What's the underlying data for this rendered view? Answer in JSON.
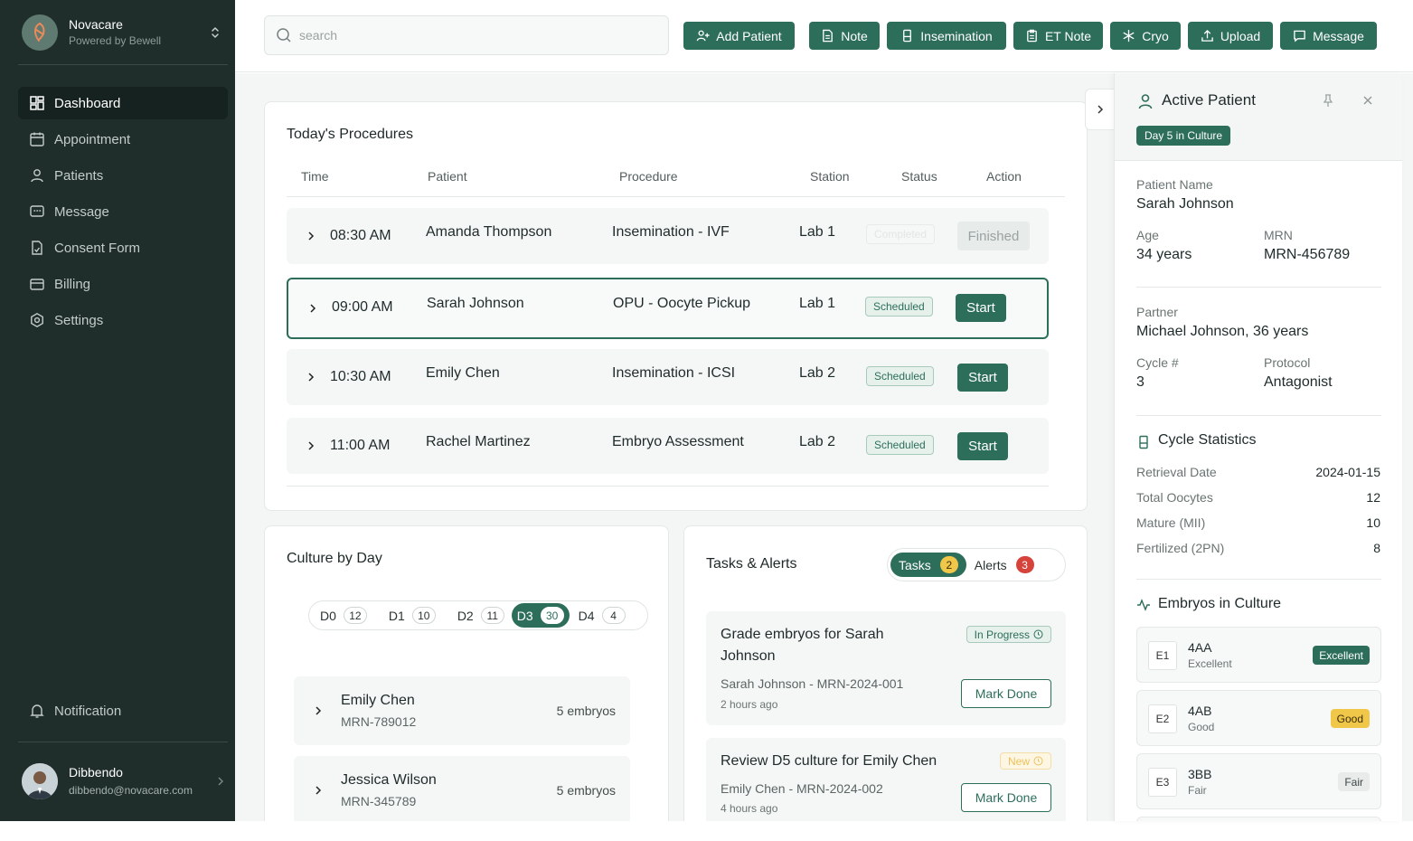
{
  "brand": {
    "name": "Novacare",
    "sub": "Powered by Bewell"
  },
  "nav": [
    {
      "label": "Dashboard",
      "icon": "dashboard-icon",
      "active": true
    },
    {
      "label": "Appointment",
      "icon": "calendar-icon"
    },
    {
      "label": "Patients",
      "icon": "user-icon"
    },
    {
      "label": "Message",
      "icon": "message-icon"
    },
    {
      "label": "Consent Form",
      "icon": "document-icon"
    },
    {
      "label": "Billing",
      "icon": "billing-icon"
    },
    {
      "label": "Settings",
      "icon": "settings-icon"
    }
  ],
  "notification_label": "Notification",
  "user": {
    "name": "Dibbendo",
    "email": "dibbendo@novacare.com"
  },
  "search": {
    "placeholder": "search"
  },
  "toolbar": {
    "add_patient": "Add Patient",
    "note": "Note",
    "insemination": "Insemination",
    "et_note": "ET Note",
    "cryo": "Cryo",
    "upload": "Upload",
    "message": "Message"
  },
  "procedures": {
    "title": "Today's Procedures",
    "headers": {
      "time": "Time",
      "patient": "Patient",
      "procedure": "Procedure",
      "station": "Station",
      "status": "Status",
      "action": "Action"
    },
    "rows": [
      {
        "time": "08:30 AM",
        "patient": "Amanda Thompson",
        "procedure": "Insemination - IVF",
        "station": "Lab 1",
        "status": "Completed",
        "action": "Finished"
      },
      {
        "time": "09:00 AM",
        "patient": "Sarah Johnson",
        "procedure": "OPU - Oocyte Pickup",
        "station": "Lab 1",
        "status": "Scheduled",
        "action": "Start"
      },
      {
        "time": "10:30 AM",
        "patient": "Emily Chen",
        "procedure": "Insemination - ICSI",
        "station": "Lab 2",
        "status": "Scheduled",
        "action": "Start"
      },
      {
        "time": "11:00 AM",
        "patient": "Rachel Martinez",
        "procedure": "Embryo Assessment",
        "station": "Lab 2",
        "status": "Scheduled",
        "action": "Start"
      }
    ]
  },
  "culture": {
    "title": "Culture by Day",
    "days": [
      {
        "label": "D0",
        "count": "12"
      },
      {
        "label": "D1",
        "count": "10"
      },
      {
        "label": "D2",
        "count": "11"
      },
      {
        "label": "D3",
        "count": "30"
      },
      {
        "label": "D4",
        "count": "4"
      }
    ],
    "patients": [
      {
        "name": "Emily Chen",
        "mrn": "MRN-789012",
        "embryos": "5 embryos"
      },
      {
        "name": "Jessica Wilson",
        "mrn": "MRN-345789",
        "embryos": "5 embryos"
      }
    ]
  },
  "tasks": {
    "title": "Tasks & Alerts",
    "tab_tasks": "Tasks",
    "tasks_count": "2",
    "tab_alerts": "Alerts",
    "alerts_count": "3",
    "items": [
      {
        "title": "Grade embryos for Sarah Johnson",
        "status": "In Progress",
        "sub": "Sarah Johnson - MRN-2024-001",
        "ago": "2 hours ago",
        "button": "Mark Done"
      },
      {
        "title": "Review D5 culture for Emily Chen",
        "status": "New",
        "sub": "Emily Chen - MRN-2024-002",
        "ago": "4 hours ago",
        "button": "Mark Done"
      }
    ]
  },
  "panel": {
    "title": "Active Patient",
    "culture_day": "Day 5 in Culture",
    "name_label": "Patient Name",
    "name": "Sarah Johnson",
    "age_label": "Age",
    "age": "34 years",
    "mrn_label": "MRN",
    "mrn": "MRN-456789",
    "partner_label": "Partner",
    "partner": "Michael Johnson, 36 years",
    "cycle_label": "Cycle #",
    "cycle": "3",
    "protocol_label": "Protocol",
    "protocol": "Antagonist",
    "stats_title": "Cycle Statistics",
    "stats": [
      {
        "label": "Retrieval Date",
        "value": "2024-01-15"
      },
      {
        "label": "Total Oocytes",
        "value": "12"
      },
      {
        "label": "Mature (MII)",
        "value": "10"
      },
      {
        "label": "Fertilized (2PN)",
        "value": "8"
      }
    ],
    "embryos_title": "Embryos in Culture",
    "embryos": [
      {
        "id": "E1",
        "grade": "4AA",
        "quality": "Excellent",
        "badge": "Excellent"
      },
      {
        "id": "E2",
        "grade": "4AB",
        "quality": "Good",
        "badge": "Good"
      },
      {
        "id": "E3",
        "grade": "3BB",
        "quality": "Fair",
        "badge": "Fair"
      }
    ]
  },
  "colors": {
    "sidebar": "#1f2e2b",
    "accent": "#2d6e5b",
    "warning": "#f1c74a",
    "danger": "#d6433b"
  }
}
